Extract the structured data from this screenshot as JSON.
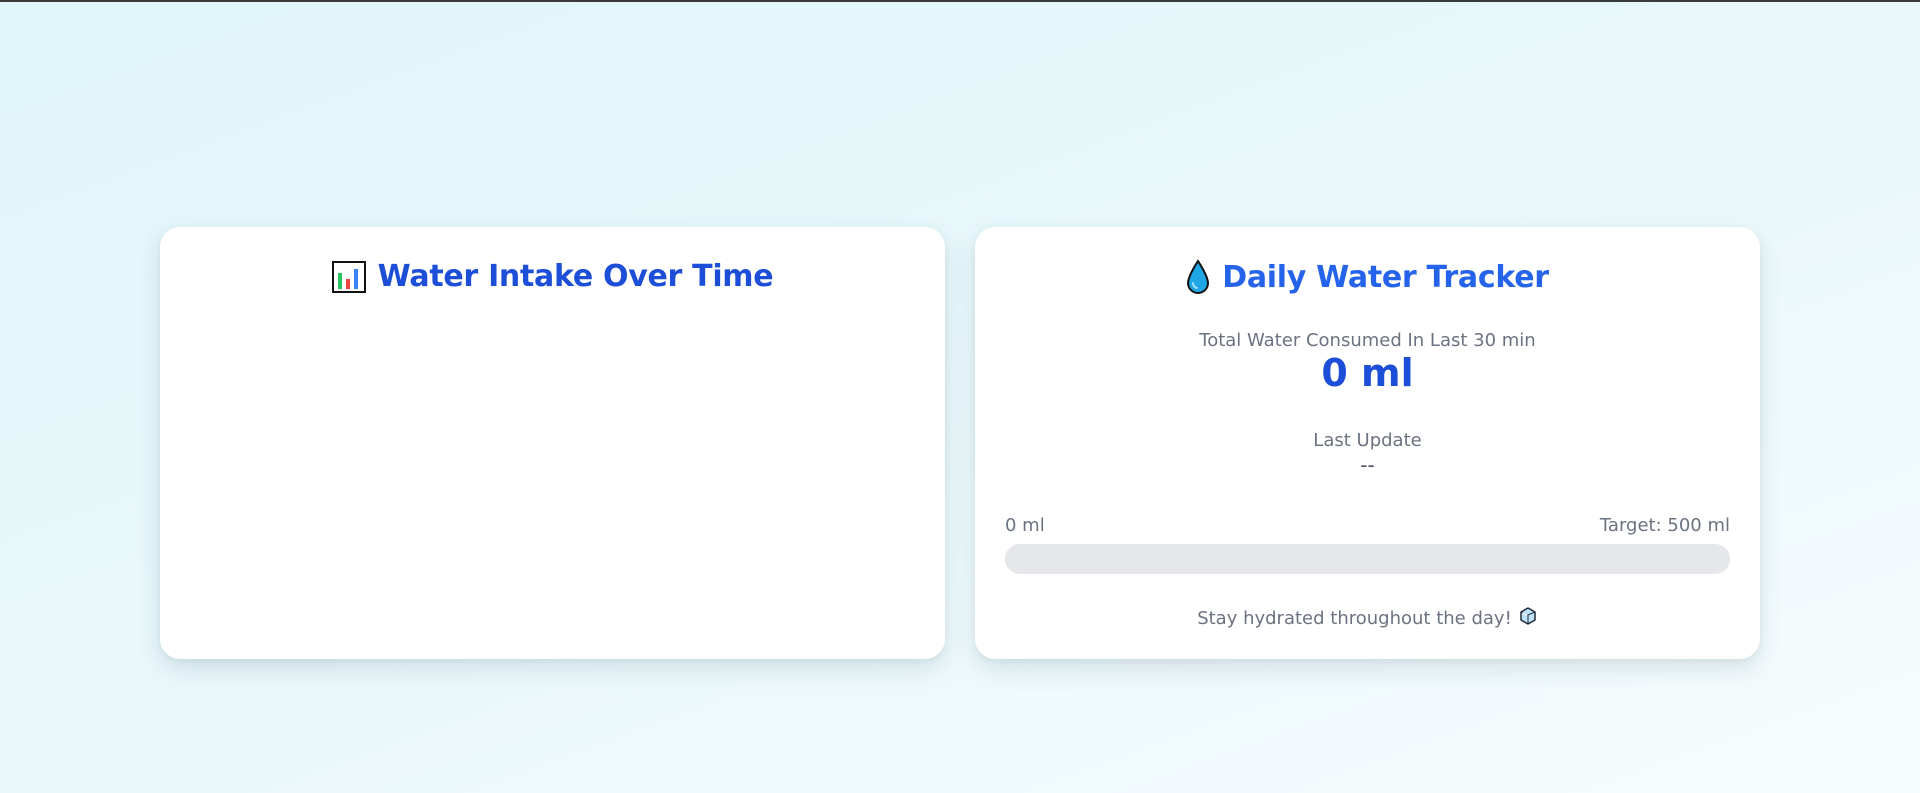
{
  "chart_card": {
    "title": "Water Intake Over Time",
    "icon": "bar-chart-icon"
  },
  "tracker_card": {
    "title": "Daily Water Tracker",
    "icon": "water-drop-icon",
    "total_label": "Total Water Consumed In Last 30 min",
    "total_value": "0 ml",
    "update_label": "Last Update",
    "update_value": "--",
    "progress": {
      "start_label": "0 ml",
      "target_label": "Target: 500 ml",
      "fraction": 0
    },
    "footer_message": "Stay hydrated throughout the day!",
    "footer_icon": "ice-cube-icon"
  },
  "colors": {
    "title_primary": "#1d4ed8",
    "title_secondary": "#2563eb",
    "progress_track": "#e5e7eb",
    "progress_fill": "#3b82f6"
  }
}
